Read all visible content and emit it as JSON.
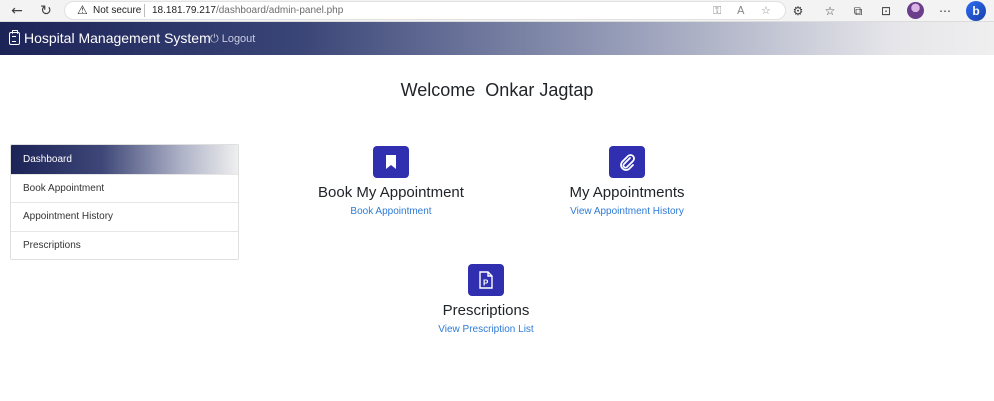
{
  "browser": {
    "security_label": "Not secure",
    "url_host": "18.181.79.217",
    "url_path": "/dashboard/admin-panel.php"
  },
  "navbar": {
    "brand": "Hospital Management System",
    "logout_label": "Logout"
  },
  "welcome": "Welcome  Onkar Jagtap",
  "sidebar": {
    "items": [
      {
        "label": "Dashboard",
        "active": true
      },
      {
        "label": "Book Appointment"
      },
      {
        "label": "Appointment History"
      },
      {
        "label": "Prescriptions"
      }
    ]
  },
  "cards": [
    {
      "title": "Book My Appointment",
      "link": "Book Appointment",
      "icon": "bookmark-icon"
    },
    {
      "title": "My Appointments",
      "link": "View Appointment History",
      "icon": "paperclip-icon"
    },
    {
      "title": "Prescriptions",
      "link": "View Prescription List",
      "icon": "prescription-file-icon"
    }
  ],
  "colors": {
    "accent": "#2f2fb0",
    "link": "#2e7bd6",
    "navbar_dark": "#1c2357"
  }
}
